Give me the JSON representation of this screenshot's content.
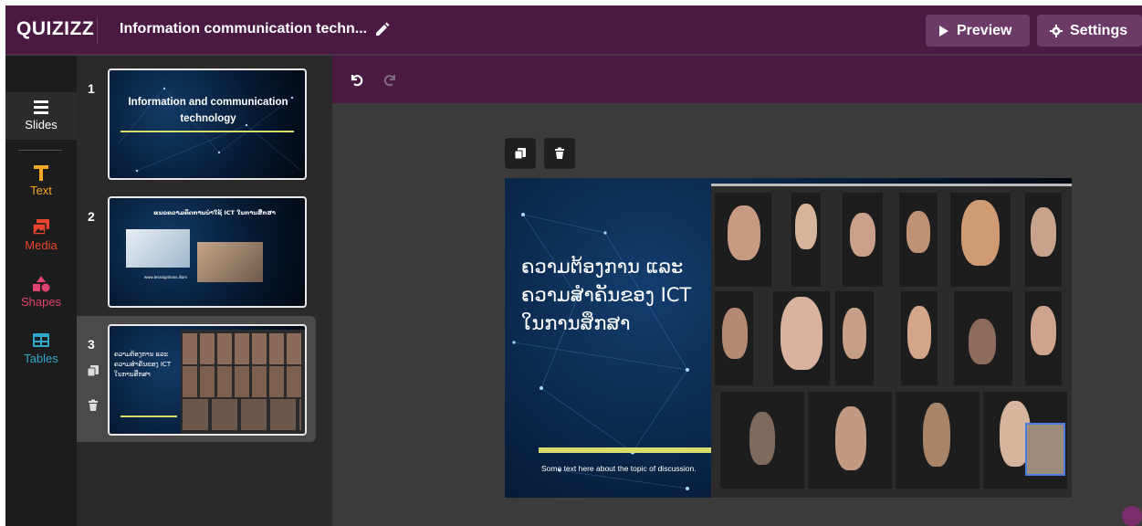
{
  "app": {
    "logo": "QUIZIZZ",
    "title": "Information communication techn...",
    "preview_label": "Preview",
    "settings_label": "Settings"
  },
  "rail": {
    "items": [
      {
        "label": "Slides",
        "icon": "slides-icon",
        "color": "#ffffff"
      },
      {
        "label": "Text",
        "icon": "text-icon",
        "color": "#f5a623"
      },
      {
        "label": "Media",
        "icon": "media-icon",
        "color": "#e8452c"
      },
      {
        "label": "Shapes",
        "icon": "shapes-icon",
        "color": "#e0436f"
      },
      {
        "label": "Tables",
        "icon": "tables-icon",
        "color": "#2fa8c9"
      }
    ]
  },
  "slides": [
    {
      "number": "1",
      "title": "Information and communication technology"
    },
    {
      "number": "2",
      "title": "ແນວຄວາມຄິດການນຳໃຊ້ ICT ໃນການສຶກສາ",
      "url": "www.lesssignhoss.illom"
    },
    {
      "number": "3",
      "title": "ຄວາມຕ້ອງການ ແລະ ຄວາມສຳຄັນຂອງ ICT ໃນການສຶກສາ"
    }
  ],
  "main_slide": {
    "title": "ຄວາມຕ້ອງການ ແລະ ຄວາມສຳຄັນຂອງ ICT ໃນການສຶກສາ",
    "footer": "Some text here about the topic of discussion."
  },
  "colors": {
    "topbar": "#4a1a43",
    "accent_line": "#d8dc6a"
  }
}
